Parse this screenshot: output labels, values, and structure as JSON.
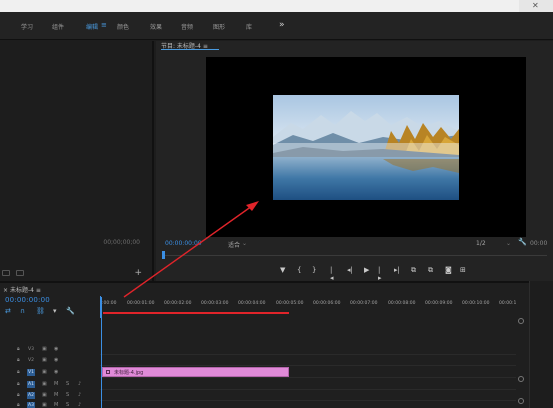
{
  "workspaces": {
    "items": [
      {
        "label": "学习",
        "active": false
      },
      {
        "label": "组件",
        "active": false
      },
      {
        "label": "编辑",
        "active": true
      },
      {
        "label": "颜色",
        "active": false
      },
      {
        "label": "效果",
        "active": false
      },
      {
        "label": "音频",
        "active": false
      },
      {
        "label": "图形",
        "active": false
      },
      {
        "label": "库",
        "active": false
      }
    ],
    "menu_glyph": "≡",
    "more": "»"
  },
  "source_monitor": {
    "timecode": "00;00;00;00",
    "add_glyph": "+"
  },
  "program_monitor": {
    "tab_label": "节目: 未标题-4",
    "tab_menu": "≡",
    "current_timecode": "00:00:00:00",
    "fit_label": "适合",
    "resolution": "1/2",
    "duration_timecode": "00:00",
    "transport": [
      "▼",
      "{",
      "}",
      "|◂",
      "◂|",
      "▶",
      "|▸",
      "▸|",
      "⧉",
      "⧉",
      "◙",
      "⊞"
    ]
  },
  "timeline": {
    "tab_label": "未标题-4",
    "tab_menu": "≡",
    "timecode": "00:00:00:00",
    "ruler_ticks": [
      ":00:00",
      "00:00:01:00",
      "00:00:02:00",
      "00:00:03:00",
      "00:00:04:00",
      "00:00:05:00",
      "00:00:06:00",
      "00:00:07:00",
      "00:00:08:00",
      "00:00:09:00",
      "00:00:10:00",
      "00:00:1"
    ],
    "tracks": [
      {
        "name": "V3",
        "sync": "▣",
        "eye": "◉"
      },
      {
        "name": "V2",
        "sync": "▣",
        "eye": "◉"
      },
      {
        "name": "V1",
        "sync": "▣",
        "eye": "◉"
      },
      {
        "name": "A1",
        "mute": "M",
        "solo": "S",
        "mic": "♪"
      },
      {
        "name": "A2",
        "mute": "M",
        "solo": "S",
        "mic": "♪"
      },
      {
        "name": "A3",
        "mute": "M",
        "solo": "S",
        "mic": "♪"
      }
    ],
    "clip_label": "未标题-4.jpg"
  },
  "colors": {
    "accent": "#3b8fe4",
    "clip": "#e08ad8",
    "annotation_arrow": "#e0242a"
  }
}
